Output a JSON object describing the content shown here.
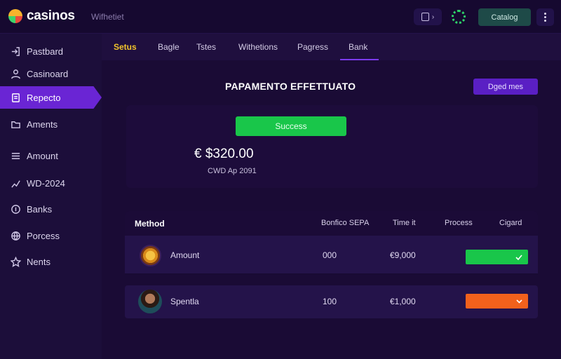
{
  "brand": {
    "name": "casinos"
  },
  "topbar": {
    "link": "Wifhetiet",
    "catalog_label": "Catalog",
    "chevron": "›"
  },
  "sidebar": {
    "items": [
      {
        "label": "Pastbard",
        "icon": "login-icon"
      },
      {
        "label": "Casinoard",
        "icon": "user-icon"
      },
      {
        "label": "Repecto",
        "icon": "document-icon",
        "active": true
      },
      {
        "label": "Aments",
        "icon": "folder-icon"
      },
      {
        "label": "Amount",
        "icon": "menu-icon"
      },
      {
        "label": "WD-2024",
        "icon": "trend-icon"
      },
      {
        "label": "Banks",
        "icon": "coin-icon"
      },
      {
        "label": "Porcess",
        "icon": "globe-icon"
      },
      {
        "label": "Nents",
        "icon": "star-icon"
      }
    ]
  },
  "tabs": [
    {
      "label": "Setus"
    },
    {
      "label": "Bagle"
    },
    {
      "label": "Tstes"
    },
    {
      "label": "Withetions"
    },
    {
      "label": "Pagress"
    },
    {
      "label": "Bank",
      "active": true
    }
  ],
  "main": {
    "heading": "PAPAMENTO EFFETTUATO",
    "details_button": "Dged mes",
    "status_button": "Success",
    "amount": "€ $320.00",
    "date": "CWD Ap 2091"
  },
  "table": {
    "headers": [
      "Method",
      "Bonfico SEPA",
      "Time it",
      "Process",
      "Cigard"
    ],
    "rows": [
      {
        "name": "Amount",
        "value": "000",
        "amount": "€9,000",
        "status": "green",
        "pill_icon": "check-icon"
      },
      {
        "name": "Spentla",
        "value": "100",
        "amount": "€1,000",
        "status": "orange",
        "pill_icon": "chevron-down-icon"
      }
    ]
  },
  "colors": {
    "accent": "#6a25d4",
    "success": "#19c64a",
    "warning": "#f2611c",
    "tab_highlight": "#f2c42b",
    "background": "#1a0b35"
  }
}
